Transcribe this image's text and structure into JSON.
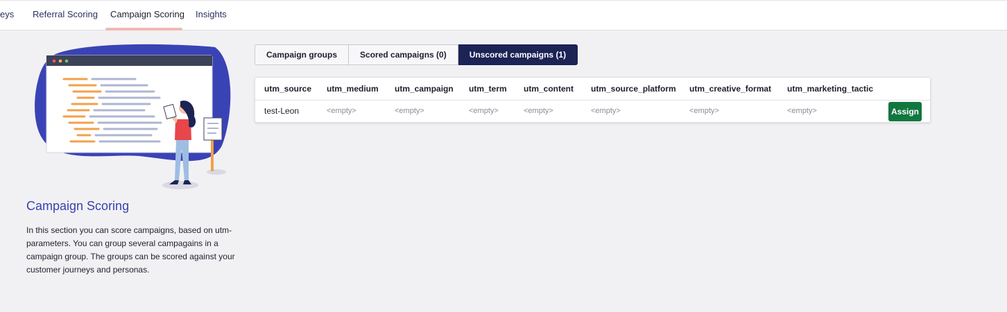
{
  "nav": {
    "items": [
      {
        "label": "eys"
      },
      {
        "label": "Referral Scoring"
      },
      {
        "label": "Campaign Scoring"
      },
      {
        "label": "Insights"
      }
    ]
  },
  "sidebar": {
    "title": "Campaign Scoring",
    "description": "In this section you can score campaigns, based on utm-parameters. You can group several campagains in a campaign group. The groups can be scored against your customer journeys and personas."
  },
  "tabs": [
    {
      "label": "Campaign groups"
    },
    {
      "label": "Scored campaigns (0)"
    },
    {
      "label": "Unscored campaigns (1)"
    }
  ],
  "table": {
    "headers": [
      "utm_source",
      "utm_medium",
      "utm_campaign",
      "utm_term",
      "utm_content",
      "utm_source_platform",
      "utm_creative_format",
      "utm_marketing_tactic"
    ],
    "rows": [
      {
        "cells": [
          "test-Leon",
          "<empty>",
          "<empty>",
          "<empty>",
          "<empty>",
          "<empty>",
          "<empty>",
          "<empty>"
        ],
        "action": "Assign"
      }
    ]
  },
  "colors": {
    "accent": "#1c2355",
    "title": "#3a41b0",
    "assign": "#11773f",
    "blob": "#3a43b5",
    "tab_underline": "#f2b8b3"
  }
}
